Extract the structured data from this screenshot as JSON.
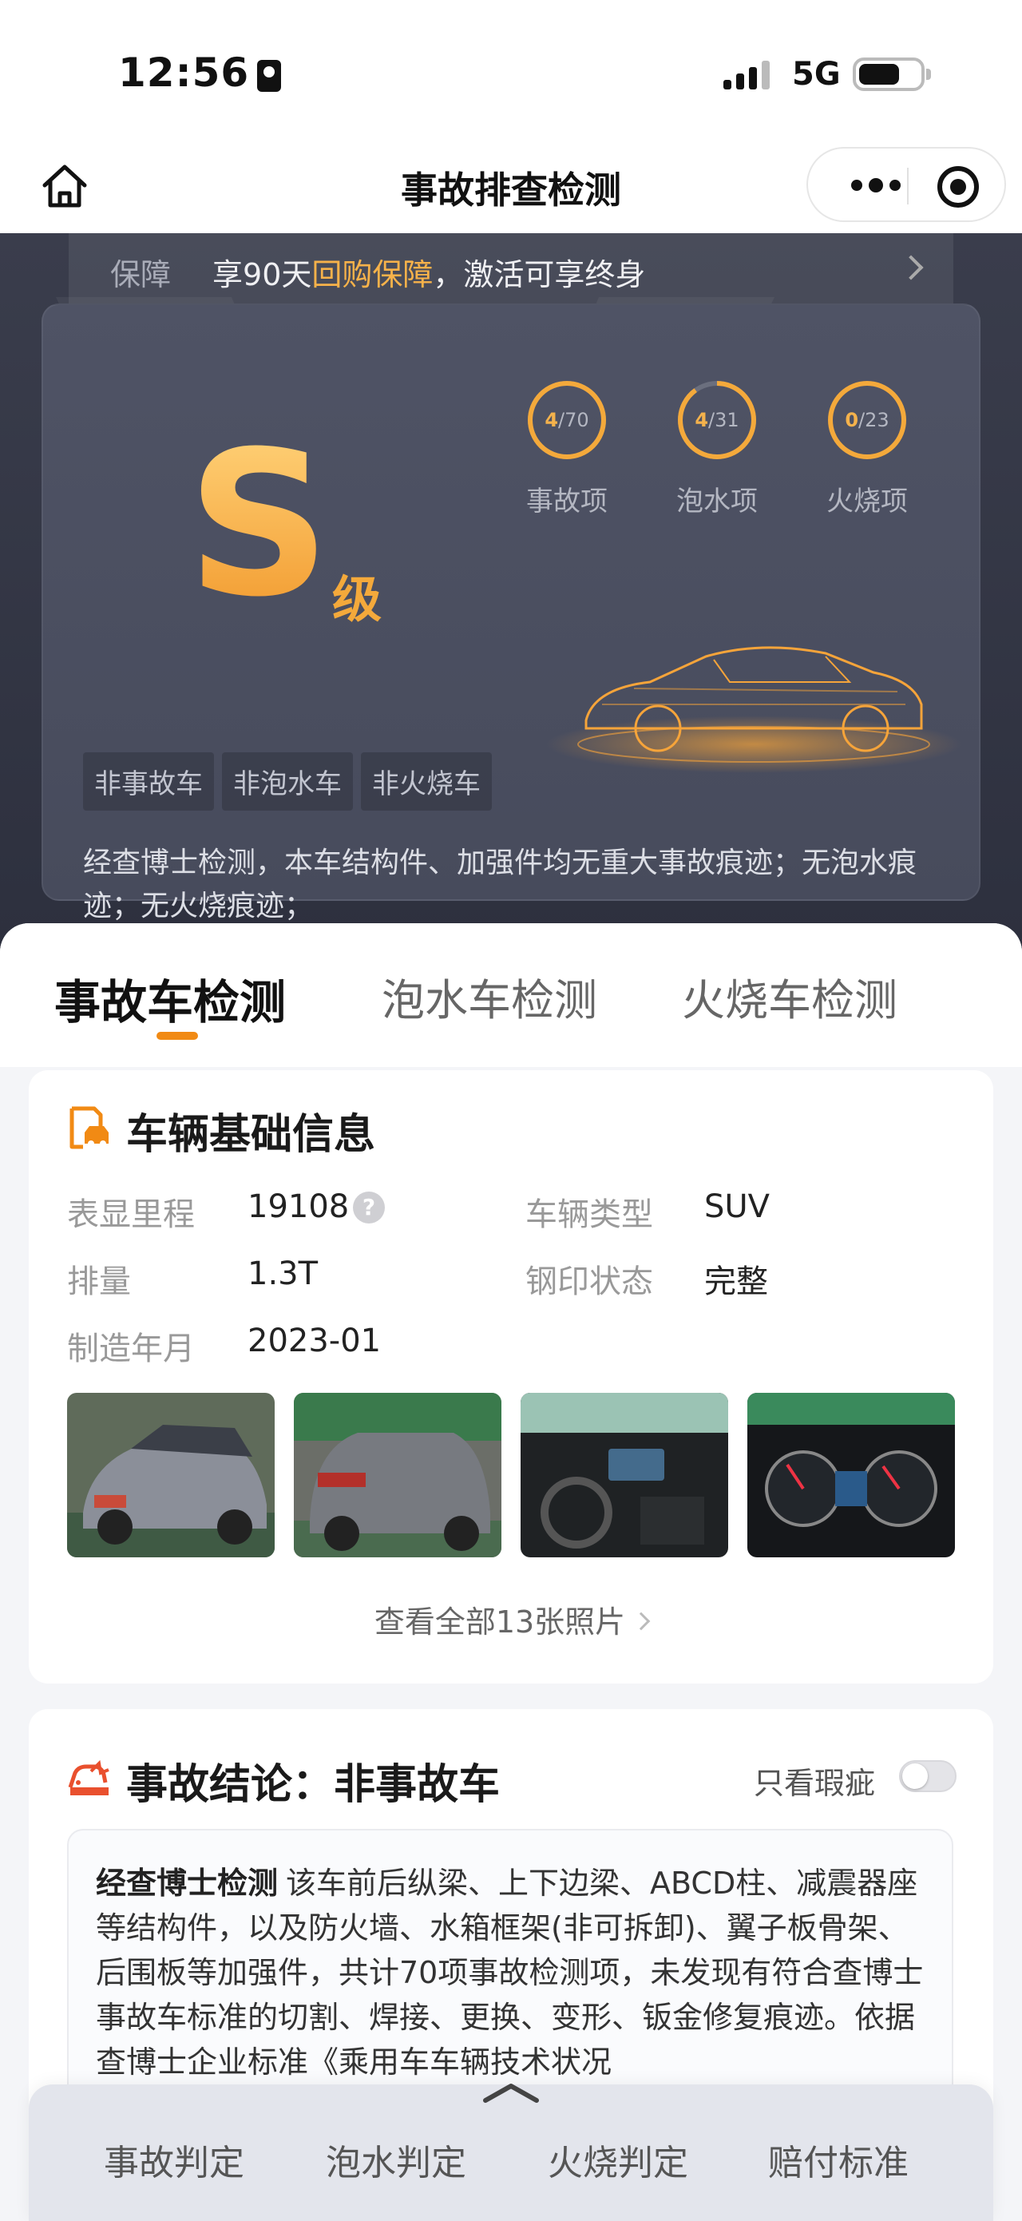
{
  "status_bar": {
    "time": "12:56",
    "network": "5G"
  },
  "nav": {
    "title": "事故排查检测"
  },
  "guarantee": {
    "label": "保障",
    "text_prefix": "享90天",
    "highlight": "回购保障",
    "text_suffix": "，激活可享终身"
  },
  "grade": {
    "letter": "S",
    "suffix": "级"
  },
  "stats": [
    {
      "value": "4",
      "total": "/70",
      "label": "事故项"
    },
    {
      "value": "4",
      "total": "/31",
      "label": "泡水项"
    },
    {
      "value": "0",
      "total": "/23",
      "label": "火烧项"
    }
  ],
  "tags": [
    "非事故车",
    "非泡水车",
    "非火烧车"
  ],
  "summary": "经查博士检测，本车结构件、加强件均无重大事故痕迹；无泡水痕迹；无火烧痕迹；",
  "tabs": [
    "事故车检测",
    "泡水车检测",
    "火烧车检测"
  ],
  "basic_info": {
    "title": "车辆基础信息",
    "fields": [
      {
        "label": "表显里程",
        "value": "19108"
      },
      {
        "label": "车辆类型",
        "value": "SUV"
      },
      {
        "label": "排量",
        "value": "1.3T"
      },
      {
        "label": "钢印状态",
        "value": "完整"
      },
      {
        "label": "制造年月",
        "value": "2023-01"
      }
    ],
    "help_icon": "question-circle-icon",
    "photos_link": "查看全部13张照片"
  },
  "conclusion": {
    "title": "事故结论：非事故车",
    "toggle_label": "只看瑕疵",
    "toggle_on": false,
    "brand": "经查博士检测",
    "text": "该车前后纵梁、上下边梁、ABCD柱、减震器座等结构件，以及防火墙、水箱框架(非可拆卸)、翼子板骨架、后围板等加强件，共计70项事故检测项，未发现有符合查博士事故车标准的切割、焊接、更换、变形、钣金修复痕迹。依据查博士企业标准《乘用车车辆技术状况"
  },
  "bottom_nav": [
    "事故判定",
    "泡水判定",
    "火烧判定",
    "赔付标准"
  ],
  "colors": {
    "accent": "#f18a14",
    "gold": "#f4a93b",
    "hero_bg": "#2d303e"
  }
}
